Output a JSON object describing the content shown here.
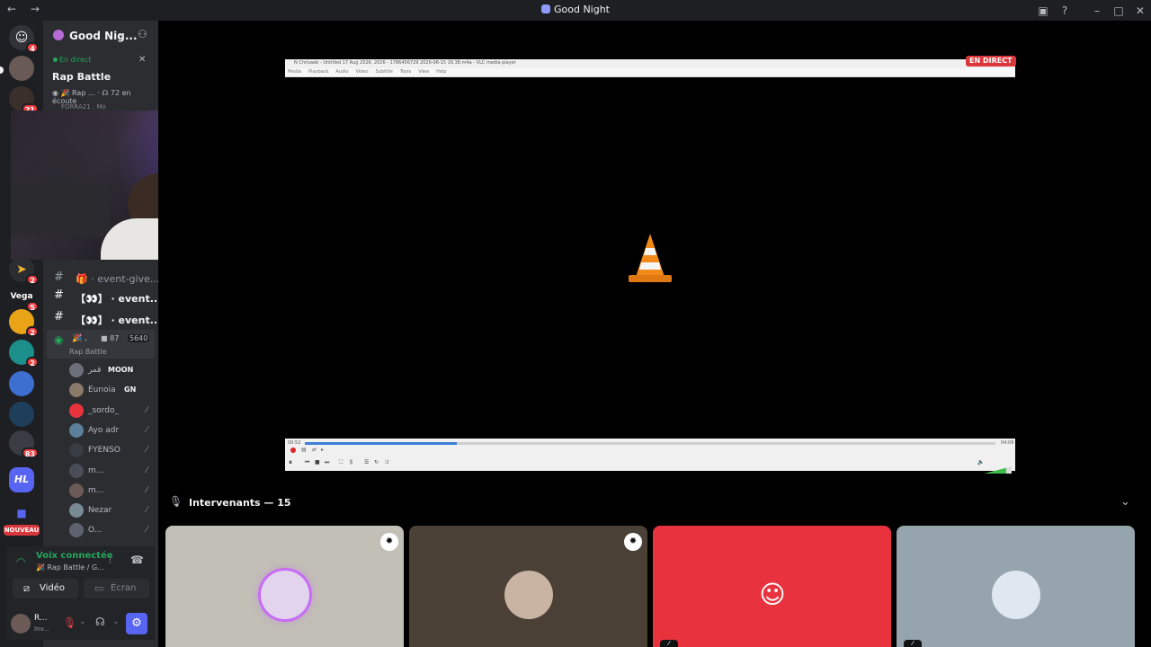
{
  "window": {
    "title": "Good Night"
  },
  "guilds": [
    {
      "name": "discord-home",
      "badge": "4"
    },
    {
      "name": "guild-1",
      "badge": ""
    },
    {
      "name": "guild-2",
      "badge": "21"
    },
    {
      "name": "guild-3",
      "badge": "2"
    },
    {
      "name": "guild-vega",
      "label": "Vega",
      "badge": "5"
    },
    {
      "name": "guild-4",
      "badge": "2"
    },
    {
      "name": "guild-5",
      "badge": "2"
    },
    {
      "name": "guild-6",
      "badge": ""
    },
    {
      "name": "guild-7",
      "badge": ""
    },
    {
      "name": "guild-folder",
      "badge": "83"
    },
    {
      "name": "guild-hl",
      "label": "HL",
      "badge": ""
    },
    {
      "name": "guild-new",
      "label": "NOUVEAU",
      "badge": ""
    }
  ],
  "server": {
    "name": "Good Nig..."
  },
  "stage_card": {
    "live_label": "En direct",
    "title": "Rap Battle",
    "meta_host": "Rap ...",
    "listeners": "72 en écoute",
    "under_text": "FORRA21 . Mo"
  },
  "channels": [
    {
      "label": "event-give...",
      "prefix": "🎁 ·"
    },
    {
      "label": "· event...",
      "prefix": "【👀】"
    },
    {
      "label": "· event...",
      "prefix": "【👀】"
    }
  ],
  "stage_channel": {
    "name": ".",
    "video_count": "87",
    "listen_count": "5640",
    "subtitle": "Rap Battle"
  },
  "members": [
    {
      "name": "قمر",
      "tag": "MOON",
      "muted": false
    },
    {
      "name": "Eunoia",
      "tag": "GN",
      "muted": false
    },
    {
      "name": "_sordo_",
      "tag": "",
      "muted": true
    },
    {
      "name": "Ayo adr",
      "tag": "",
      "muted": true
    },
    {
      "name": "FYENSO",
      "tag": "",
      "muted": true
    },
    {
      "name": "m...",
      "tag": "",
      "muted": true
    },
    {
      "name": "m...",
      "tag": "",
      "muted": true
    },
    {
      "name": "Nezar",
      "tag": "",
      "muted": true
    },
    {
      "name": "O...",
      "tag": "",
      "muted": true
    }
  ],
  "voice": {
    "status": "Voix connectée",
    "channel": "Rap Battle / G...",
    "video_btn": "Vidéo",
    "screen_btn": "Écran"
  },
  "user": {
    "name": "R...",
    "status": "Inv..."
  },
  "player": {
    "window_title": "N Chrisaeb - Untitled 17 Aug 2026, 2026 - 1786456729 2026-06-15 16.38.m4a - VLC media player",
    "menu": [
      "Media",
      "Playback",
      "Audio",
      "Video",
      "Subtitle",
      "Tools",
      "View",
      "Help"
    ],
    "time_elapsed": "00:52",
    "time_total": "04:09",
    "progress": 0.22,
    "live_badge": "EN DIRECT"
  },
  "speakers": {
    "label": "Intervenants — 15",
    "tiles": [
      {
        "bg": "#c2bfb6",
        "ring": "#c76cf5",
        "moderator": true,
        "muted": false
      },
      {
        "bg": "#4a4035",
        "ring": "",
        "moderator": true,
        "muted": false
      },
      {
        "bg": "#e8333f",
        "ring": "",
        "moderator": false,
        "muted": true
      },
      {
        "bg": "#95a4ad",
        "ring": "",
        "moderator": false,
        "muted": true
      }
    ]
  },
  "colors": {
    "accent": "#5865f2",
    "live": "#da373c",
    "voice_green": "#23a55a"
  }
}
